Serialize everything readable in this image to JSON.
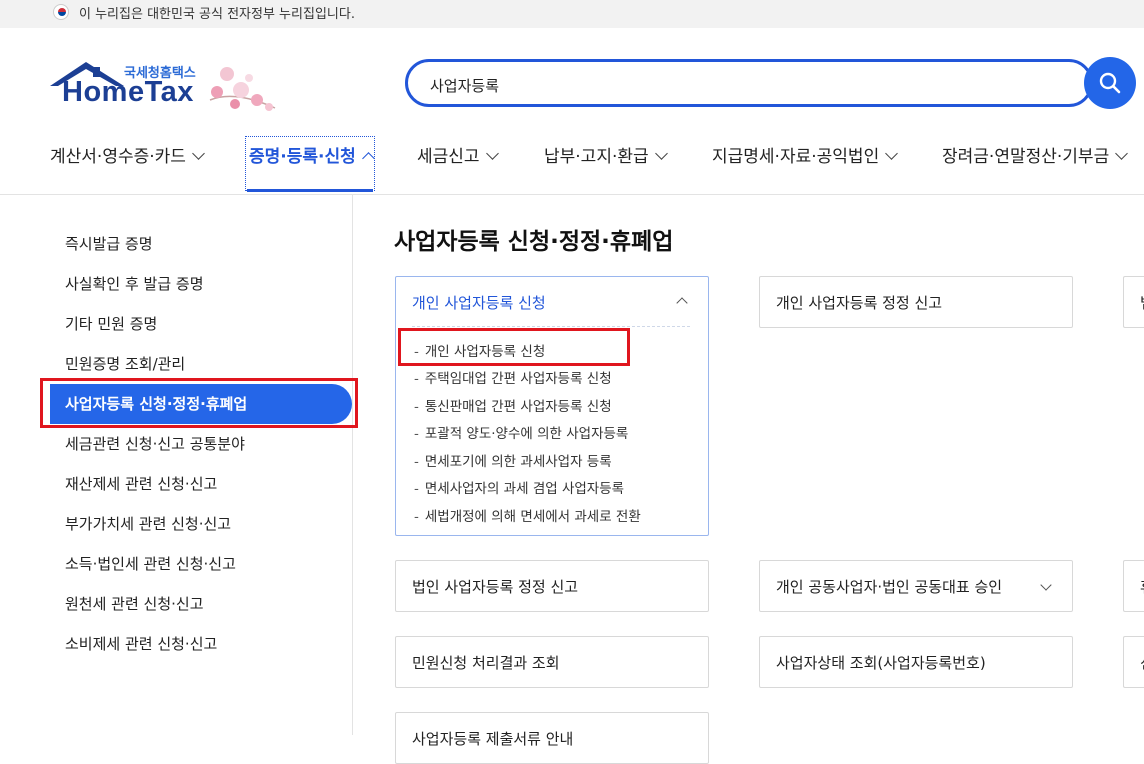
{
  "gov_banner": {
    "text": "이 누리집은 대한민국 공식 전자정부 누리집입니다."
  },
  "logo": {
    "kor": "국세청홈택스",
    "en": "HomeTax"
  },
  "search": {
    "value": "사업자등록"
  },
  "gnb": [
    {
      "label": "계산서·영수증·카드"
    },
    {
      "label": "증명·등록·신청"
    },
    {
      "label": "세금신고"
    },
    {
      "label": "납부·고지·환급"
    },
    {
      "label": "지급명세·자료·공익법인"
    },
    {
      "label": "장려금·연말정산·기부금"
    }
  ],
  "sidebar": {
    "items": [
      {
        "label": "즉시발급 증명"
      },
      {
        "label": "사실확인 후 발급 증명"
      },
      {
        "label": "기타 민원 증명"
      },
      {
        "label": "민원증명 조회/관리"
      },
      {
        "label": "사업자등록 신청·정정·휴폐업"
      },
      {
        "label": "세금관련 신청·신고 공통분야"
      },
      {
        "label": "재산제세 관련 신청·신고"
      },
      {
        "label": "부가가치세 관련 신청·신고"
      },
      {
        "label": "소득·법인세 관련 신청·신고"
      },
      {
        "label": "원천세 관련 신청·신고"
      },
      {
        "label": "소비제세 관련 신청·신고"
      }
    ]
  },
  "main": {
    "title": "사업자등록 신청·정정·휴폐업",
    "open_card": {
      "label": "개인 사업자등록 신청",
      "sub_items": [
        "개인 사업자등록 신청",
        "주택임대업 간편 사업자등록 신청",
        "통신판매업 간편 사업자등록 신청",
        "포괄적 양도·양수에 의한 사업자등록",
        "면세포기에 의한 과세사업자 등록",
        "면세사업자의 과세 겸업 사업자등록",
        "세법개정에 의해 면세에서 과세로 전환"
      ]
    },
    "cards": [
      {
        "label": "개인 사업자등록 정정 신고"
      },
      {
        "label": "법인 사업자등록 정정 신고"
      },
      {
        "label": "개인 공동사업자·법인 공동대표 승인"
      },
      {
        "label": "민원신청 처리결과 조회"
      },
      {
        "label": "사업자상태 조회(사업자등록번호)"
      },
      {
        "label": "사업자등록 제출서류 안내"
      }
    ],
    "cut_cards": [
      {
        "label": "법"
      },
      {
        "label": "휴"
      },
      {
        "label": "신"
      }
    ]
  },
  "colors": {
    "brand": "#2256d9",
    "active_bg": "#2566e8",
    "highlight": "#e0161e"
  }
}
